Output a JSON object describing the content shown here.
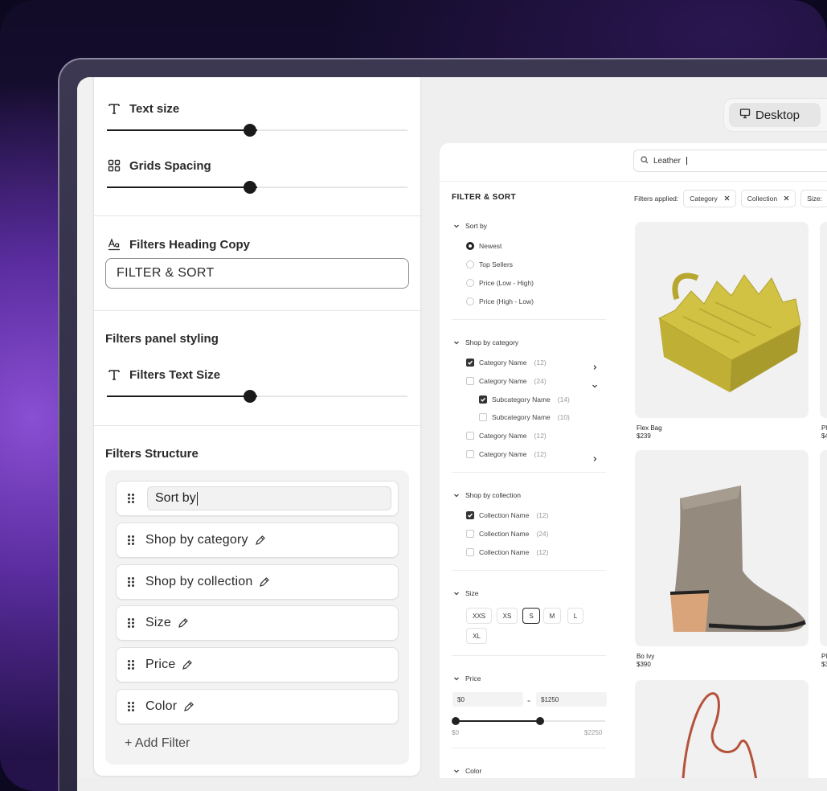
{
  "settings": {
    "text_size_label": "Text size",
    "text_size_value": 0.5,
    "grid_spacing_label": "Grids Spacing",
    "grid_spacing_value": 0.5,
    "filters_heading_label": "Filters Heading Copy",
    "filters_heading_value": "FILTER & SORT",
    "panel_styling_title": "Filters panel styling",
    "filters_text_size_label": "Filters Text Size",
    "filters_text_size_value": 0.5,
    "structure_title": "Filters Structure",
    "structure_items": [
      "Sort by",
      "Shop by category",
      "Shop by collection",
      "Size",
      "Price",
      "Color"
    ],
    "add_filter_label": "+ Add Filter"
  },
  "toolbar": {
    "device_label": "Desktop"
  },
  "preview": {
    "search_value": "Leather",
    "filters_title": "FILTER & SORT",
    "applied_label": "Filters applied:",
    "applied_chips": [
      "Category",
      "Collection",
      "Size:"
    ],
    "sort_by": {
      "title": "Sort by",
      "options": [
        "Newest",
        "Top Sellers",
        "Price (Low - High)",
        "Price (High - Low)"
      ],
      "selected": "Newest"
    },
    "category": {
      "title": "Shop by category",
      "items": [
        {
          "label": "Category Name",
          "count": "(12)",
          "checked": true
        },
        {
          "label": "Category Name",
          "count": "(24)",
          "checked": false
        },
        {
          "label": "Subcategory Name",
          "count": "(14)",
          "checked": true
        },
        {
          "label": "Subcategory Name",
          "count": "(10)",
          "checked": false
        },
        {
          "label": "Category Name",
          "count": "(12)",
          "checked": false
        },
        {
          "label": "Category Name",
          "count": "(12)",
          "checked": false
        }
      ]
    },
    "collection": {
      "title": "Shop by collection",
      "items": [
        {
          "label": "Collection Name",
          "count": "(12)",
          "checked": true
        },
        {
          "label": "Collection Name",
          "count": "(24)",
          "checked": false
        },
        {
          "label": "Collection Name",
          "count": "(12)",
          "checked": false
        }
      ]
    },
    "size": {
      "title": "Size",
      "options": [
        "XXS",
        "XS",
        "S",
        "M",
        "L",
        "XL"
      ],
      "selected": "S"
    },
    "price": {
      "title": "Price",
      "min_value": "$0",
      "max_value": "$1250",
      "range_min_label": "$0",
      "range_max_label": "$2250",
      "range_fraction": [
        0,
        0.556
      ]
    },
    "color": {
      "title": "Color"
    },
    "products": [
      {
        "name": "Flex Bag",
        "price": "$239"
      },
      {
        "name": "Bo Ivy",
        "price": "$390"
      }
    ],
    "partial_products": [
      {
        "name": "Pl",
        "price": "$4"
      },
      {
        "name": "Pl",
        "price": "$3"
      }
    ]
  },
  "colors": {
    "accent": "#1a1a1a",
    "bag": "#c9b83e",
    "boot": "#8f857a",
    "heel": "#d8a27a",
    "strap": "#b5523a"
  }
}
